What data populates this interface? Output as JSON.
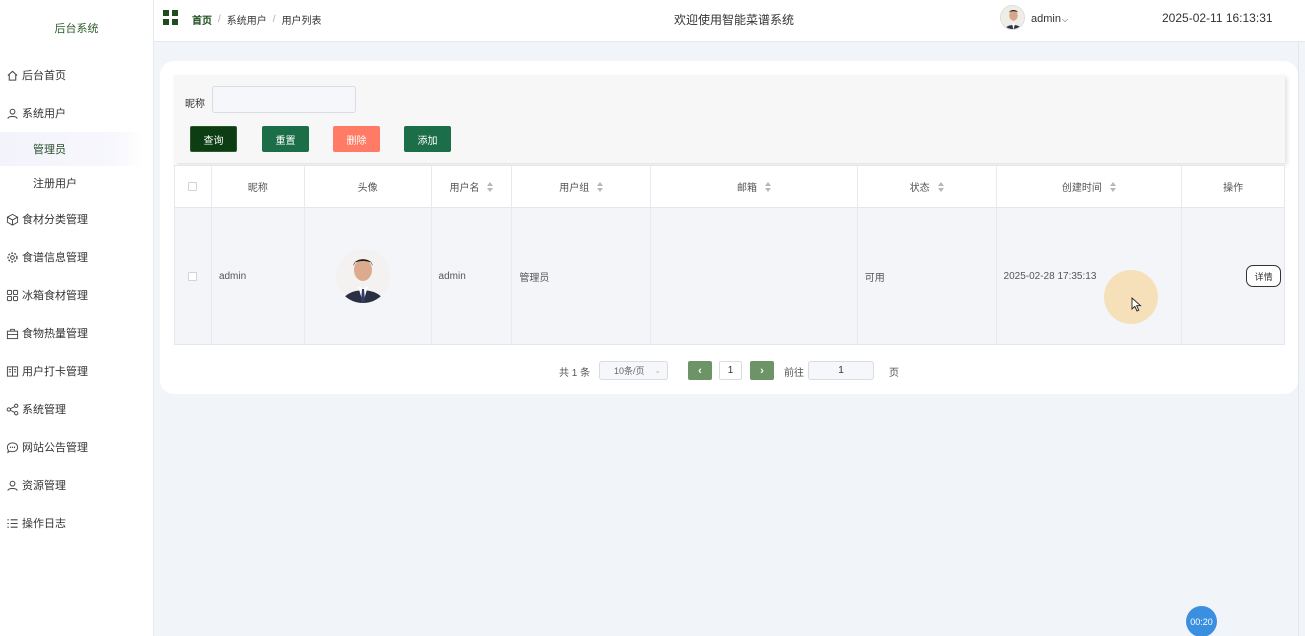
{
  "app": {
    "title": "后台系统"
  },
  "sidebar": {
    "items": [
      {
        "label": "后台首页",
        "icon": "home-icon"
      },
      {
        "label": "系统用户",
        "icon": "user-icon",
        "children": [
          {
            "label": "管理员",
            "active": true
          },
          {
            "label": "注册用户"
          }
        ]
      },
      {
        "label": "食材分类管理",
        "icon": "cube-icon"
      },
      {
        "label": "食谱信息管理",
        "icon": "gear-icon"
      },
      {
        "label": "冰箱食材管理",
        "icon": "grid-icon"
      },
      {
        "label": "食物热量管理",
        "icon": "briefcase-icon"
      },
      {
        "label": "用户打卡管理",
        "icon": "book-icon"
      },
      {
        "label": "系统管理",
        "icon": "share-icon"
      },
      {
        "label": "网站公告管理",
        "icon": "chat-icon"
      },
      {
        "label": "资源管理",
        "icon": "user-icon"
      },
      {
        "label": "操作日志",
        "icon": "list-icon"
      }
    ]
  },
  "header": {
    "breadcrumb": [
      "首页",
      "系统用户",
      "用户列表"
    ],
    "welcome": "欢迎使用智能菜谱系统",
    "user": "admin",
    "datetime": "2025-02-11 16:13:31"
  },
  "search": {
    "label": "昵称",
    "value": "",
    "buttons": {
      "query": "查询",
      "reset": "重置",
      "delete": "删除",
      "add": "添加"
    }
  },
  "table": {
    "headers": [
      "昵称",
      "头像",
      "用户名",
      "用户组",
      "邮箱",
      "状态",
      "创建时间",
      "操作"
    ],
    "rows": [
      {
        "nickname": "admin",
        "username": "admin",
        "group": "管理员",
        "email": "",
        "status": "可用",
        "created": "2025-02-28 17:35:13",
        "action": "详情"
      }
    ]
  },
  "pagination": {
    "total": "共 1 条",
    "page_size": "10条/页",
    "current": "1",
    "goto_label": "前往",
    "goto_value": "1",
    "page_suffix": "页"
  },
  "timer": "00:20"
}
